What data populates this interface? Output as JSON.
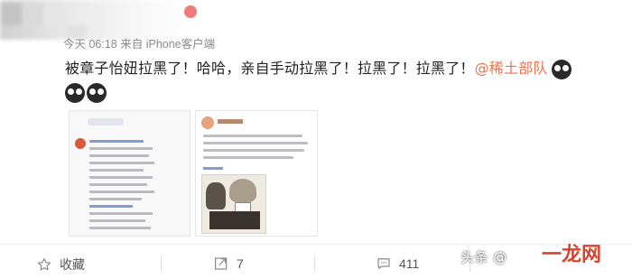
{
  "post": {
    "meta": "今天 06:18 来自 iPhone客户端",
    "text_main": "被章子怡妞拉黑了！哈哈，亲自手动拉黑了！拉黑了！拉黑了！",
    "mention": "@稀土部队",
    "emoji_name": "doge-emoji"
  },
  "images": [
    {
      "name": "screenshot-weibo-thread"
    },
    {
      "name": "screenshot-comic-post"
    }
  ],
  "actions": {
    "favorite_label": "收藏",
    "repost_count": "7",
    "comment_count": "411"
  },
  "watermark": {
    "text": "头条 @",
    "logo": "一龙网"
  }
}
